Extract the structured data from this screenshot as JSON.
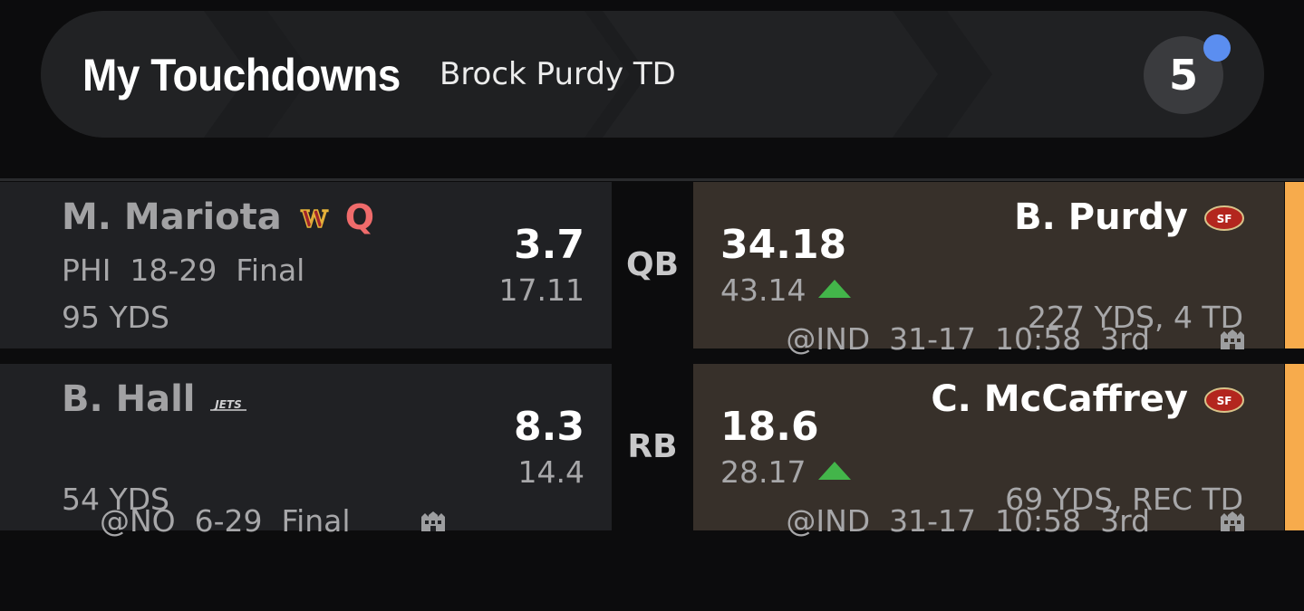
{
  "header": {
    "title": "My Touchdowns",
    "subtitle": "Brock Purdy TD",
    "badge_count": "5",
    "badge_dot_color": "#5b8ef0"
  },
  "rows": [
    {
      "position": "QB",
      "left": {
        "name": "M. Mariota",
        "team_logo": "commanders-logo",
        "status_tag": "Q",
        "game_info": "PHI  18-29  Final",
        "stats": "95 YDS",
        "score": "3.7",
        "projection": "17.11"
      },
      "right": {
        "name": "B. Purdy",
        "team_logo": "49ers-logo",
        "game_info": "@IND  31-17  10:58  3rd",
        "stats": "227 YDS, 4 TD",
        "score": "34.18",
        "projection": "43.14",
        "trend": "up"
      }
    },
    {
      "position": "RB",
      "left": {
        "name": "B. Hall",
        "team_logo": "jets-logo",
        "game_info": "@NO  6-29  Final",
        "stats": "54 YDS",
        "score": "8.3",
        "projection": "14.4"
      },
      "right": {
        "name": "C. McCaffrey",
        "team_logo": "49ers-logo",
        "game_info": "@IND  31-17  10:58  3rd",
        "stats": "69 YDS, REC TD",
        "score": "18.6",
        "projection": "28.17",
        "trend": "up"
      }
    }
  ],
  "colors": {
    "accent": "#f7ab4c",
    "trend_up": "#43b54a",
    "injury_tag": "#ef6b6b"
  }
}
